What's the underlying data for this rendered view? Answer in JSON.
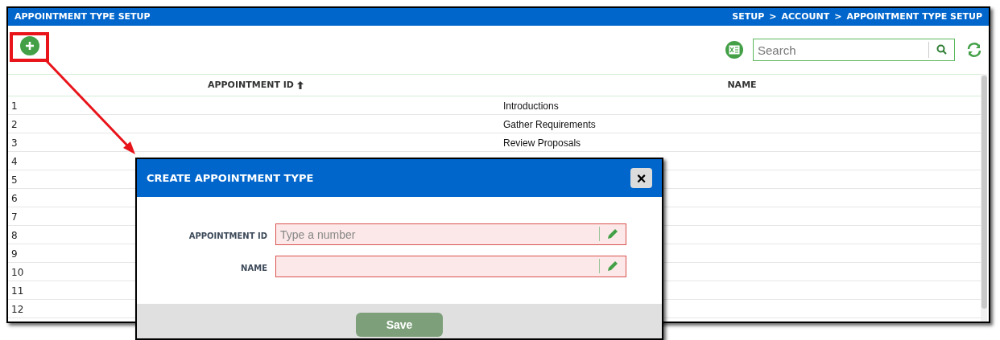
{
  "header": {
    "title": "APPOINTMENT TYPE SETUP",
    "breadcrumb": [
      "SETUP",
      "ACCOUNT",
      "APPOINTMENT TYPE SETUP"
    ],
    "separator": ">"
  },
  "toolbar": {
    "search": {
      "placeholder": "Search"
    }
  },
  "table": {
    "columns": [
      {
        "label": "APPOINTMENT ID",
        "sorted": true
      },
      {
        "label": "NAME"
      }
    ],
    "rows": [
      {
        "id": "1",
        "name": "Introductions"
      },
      {
        "id": "2",
        "name": "Gather Requirements"
      },
      {
        "id": "3",
        "name": "Review Proposals"
      },
      {
        "id": "4"
      },
      {
        "id": "5"
      },
      {
        "id": "6"
      },
      {
        "id": "7"
      },
      {
        "id": "8"
      },
      {
        "id": "9"
      },
      {
        "id": "10"
      },
      {
        "id": "11"
      },
      {
        "id": "12"
      }
    ]
  },
  "dialog": {
    "title": "CREATE APPOINTMENT TYPE",
    "fields": [
      {
        "label": "APPOINTMENT ID",
        "placeholder": "Type a number",
        "invalid": true
      },
      {
        "label": "NAME",
        "invalid": true
      }
    ],
    "save": "Save",
    "close": "×"
  }
}
